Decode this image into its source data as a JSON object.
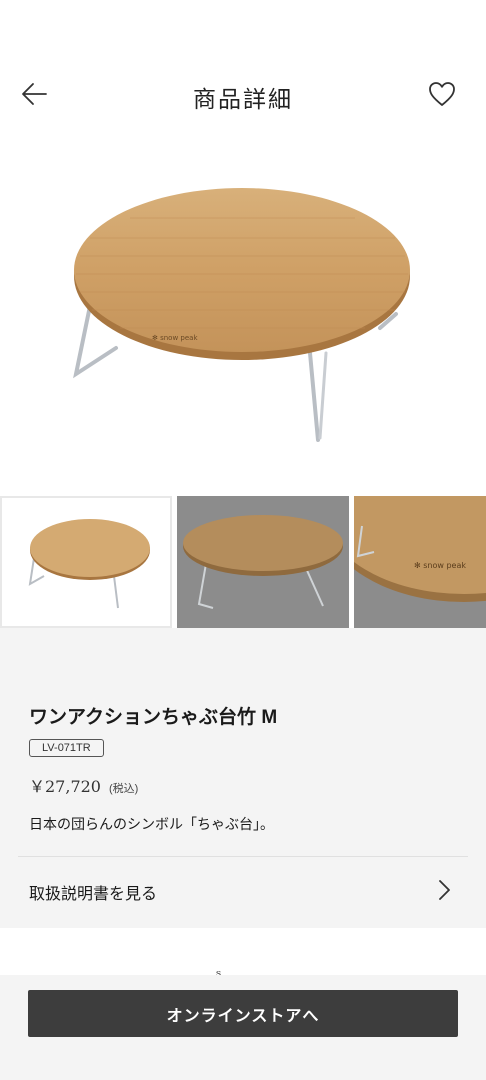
{
  "header": {
    "title": "商品詳細",
    "back_icon": "arrow-left-icon",
    "favorite_icon": "heart-icon"
  },
  "gallery": {
    "main_image": "round-bamboo-table",
    "thumbnails": [
      "table-white-background",
      "table-gray-background",
      "table-closeup-logo"
    ],
    "selected_index": 0
  },
  "product": {
    "name": "ワンアクションちゃぶ台竹 M",
    "code": "LV-071TR",
    "price": "￥27,720",
    "tax_note": "(税込)",
    "description": "日本の団らんのシンボル「ちゃぶ台」。"
  },
  "manual": {
    "label": "取扱説明書を見る",
    "icon": "chevron-right-icon"
  },
  "footer": {
    "cta_label": "オンラインストアへ"
  },
  "colors": {
    "cta_background": "#3d3d3d",
    "info_background": "#f4f4f4",
    "thumb_gray": "#8c8c8c"
  }
}
